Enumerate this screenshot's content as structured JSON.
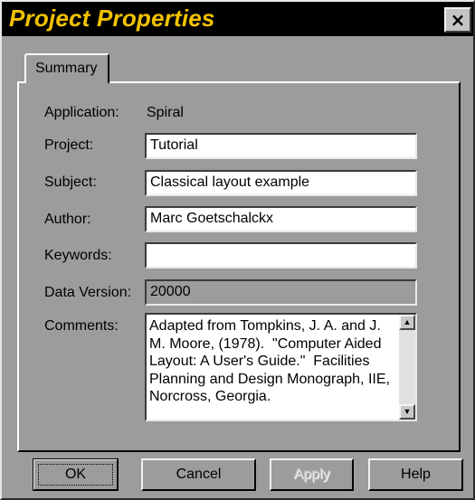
{
  "window": {
    "title": "Project Properties",
    "close_label": "×"
  },
  "tabs": [
    {
      "label": "Summary",
      "selected": true
    }
  ],
  "form": {
    "application": {
      "label": "Application:",
      "value": "Spiral"
    },
    "project": {
      "label": "Project:",
      "value": "Tutorial"
    },
    "subject": {
      "label": "Subject:",
      "value": "Classical layout example"
    },
    "author": {
      "label": "Author:",
      "value": "Marc Goetschalckx"
    },
    "keywords": {
      "label": "Keywords:",
      "value": ""
    },
    "data_version": {
      "label": "Data Version:",
      "value": "20000",
      "disabled": true
    },
    "comments": {
      "label": "Comments:",
      "value": "Adapted from Tompkins, J. A. and J. M. Moore, (1978).  \"Computer Aided Layout: A User's Guide.\"  Facilities Planning and Design Monograph, IIE, Norcross, Georgia."
    }
  },
  "buttons": {
    "ok": "OK",
    "cancel": "Cancel",
    "apply": "Apply",
    "help": "Help"
  },
  "colors": {
    "title_bar_bg": "#000000",
    "title_text": "#f2c200",
    "dialog_bg": "#9c9c9c"
  }
}
